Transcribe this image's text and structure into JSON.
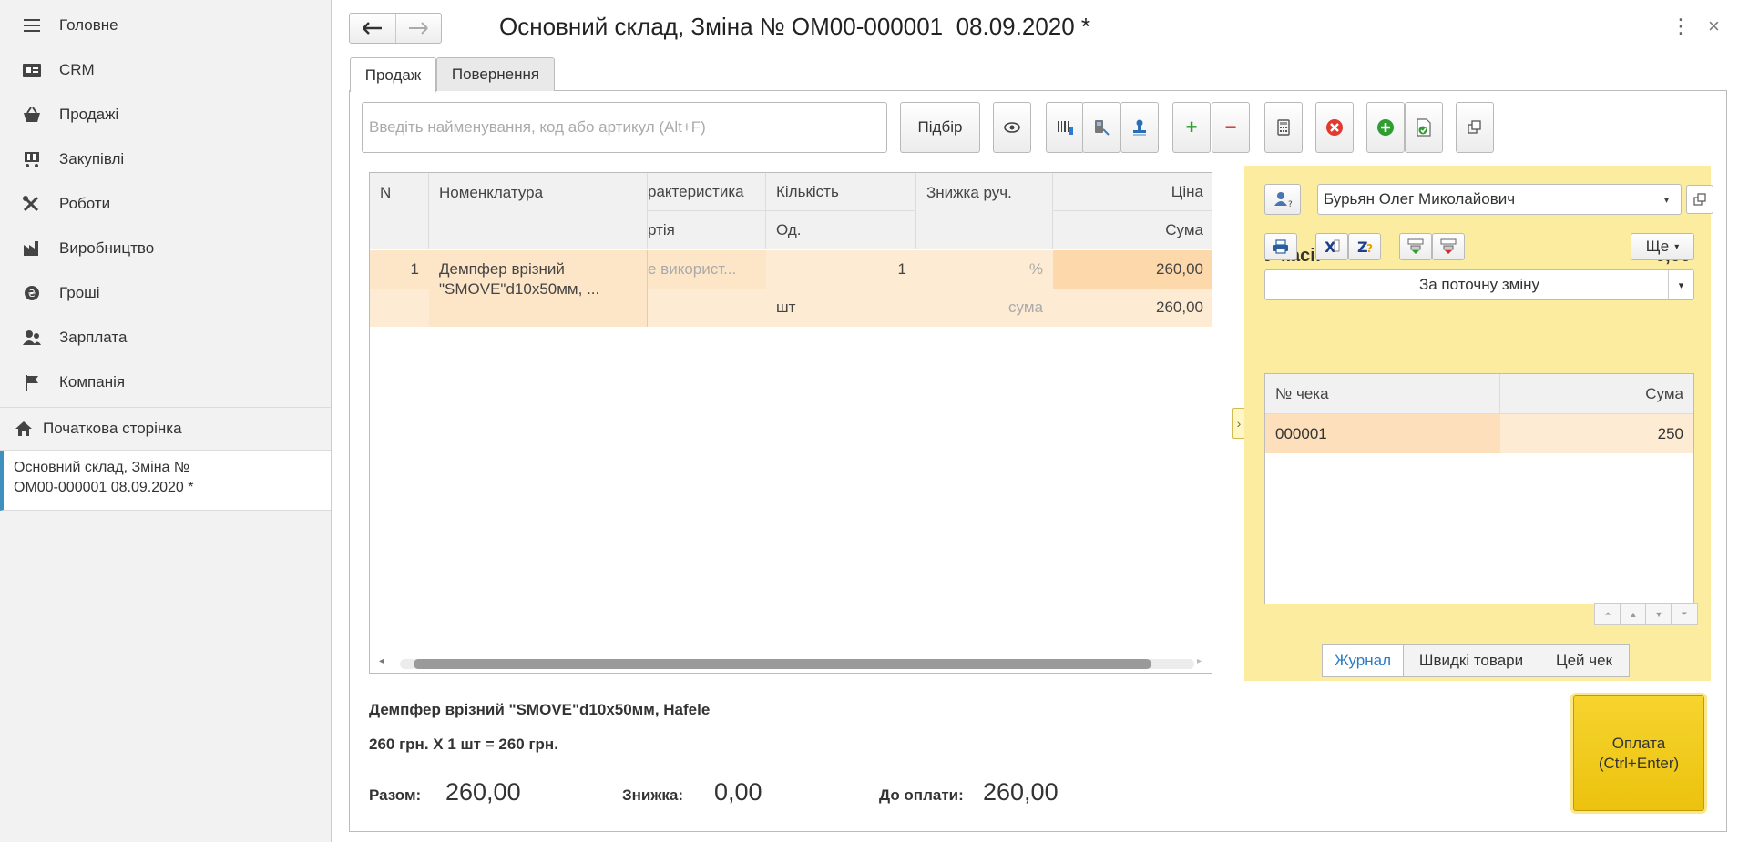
{
  "sidebar": {
    "items": [
      {
        "label": "Головне",
        "icon": "menu-icon"
      },
      {
        "label": "CRM",
        "icon": "crm-card-icon"
      },
      {
        "label": "Продажі",
        "icon": "basket-icon"
      },
      {
        "label": "Закупівлі",
        "icon": "cart-icon"
      },
      {
        "label": "Роботи",
        "icon": "tools-icon"
      },
      {
        "label": "Виробництво",
        "icon": "factory-icon"
      },
      {
        "label": "Гроші",
        "icon": "money-icon"
      },
      {
        "label": "Зарплата",
        "icon": "people-icon"
      },
      {
        "label": "Компанія",
        "icon": "flag-icon"
      }
    ],
    "home_label": "Початкова сторінка",
    "open_doc_line1": "Основний склад, Зміна №",
    "open_doc_line2": "ОМ00-000001  08.09.2020 *"
  },
  "header": {
    "title": "Основний склад, Зміна № ОМ00-000001  08.09.2020 *"
  },
  "tabs": {
    "sale": "Продаж",
    "return": "Повернення"
  },
  "toolbar": {
    "search_placeholder": "Введіть найменування, код або артикул (Alt+F)",
    "pick_label": "Підбір"
  },
  "goods": {
    "headers": {
      "n": "N",
      "nomenclature": "Номенклатура",
      "characteristic": "рактеристика",
      "batch": "ртія",
      "quantity": "Кількість",
      "unit": "Од.",
      "discount": "Знижка руч.",
      "price": "Ціна",
      "sum": "Сума"
    },
    "rows": [
      {
        "n": "1",
        "name_line1": "Демпфер врізний",
        "name_line2": "\"SMOVE\"d10x50мм, ...",
        "characteristic": "е використ...",
        "quantity": "1",
        "unit": "шт",
        "discount_pct": "%",
        "discount_sum": "сума",
        "price": "260,00",
        "sum": "260,00"
      }
    ]
  },
  "panel": {
    "cashier": "Бурьян Олег Миколайович",
    "in_cash_label": "У касі:",
    "in_cash_value": "0,00",
    "more_label": "Ще",
    "period": "За поточну зміну",
    "receipts_headers": {
      "no": "№ чека",
      "sum": "Сума"
    },
    "receipts": [
      {
        "no": "000001",
        "sum": "250"
      }
    ],
    "switch": {
      "journal": "Журнал",
      "quick": "Швидкі товари",
      "this": "Цей чек"
    }
  },
  "footer": {
    "item_line": "Демпфер врізний \"SMOVE\"d10x50мм, Hafele",
    "calc_line": "260 грн. X 1 шт = 260 грн.",
    "total_label": "Разом:",
    "total_value": "260,00",
    "discount_label": "Знижка:",
    "discount_value": "0,00",
    "to_pay_label": "До оплати:",
    "to_pay_value": "260,00",
    "pay_line1": "Оплата",
    "pay_line2": "(Ctrl+Enter)"
  },
  "colors": {
    "accent_yellow": "#ecc20e",
    "panel_yellow": "#fbeca0",
    "row_highlight": "#fde0bb",
    "link_blue": "#2b7bc4"
  }
}
